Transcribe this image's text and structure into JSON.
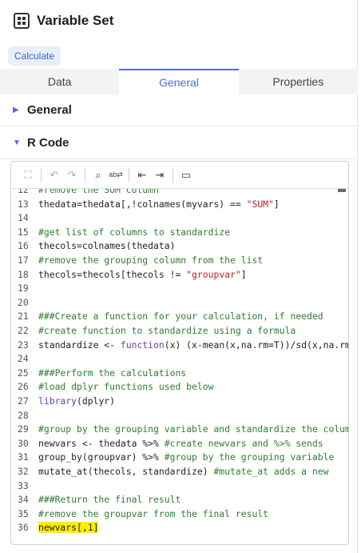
{
  "header": {
    "title": "Variable Set",
    "icon": "grid-icon"
  },
  "calculate_label": "Calculate",
  "tabs": [
    {
      "label": "Data",
      "active": false
    },
    {
      "label": "General",
      "active": true
    },
    {
      "label": "Properties",
      "active": false
    }
  ],
  "sections": [
    {
      "label": "General",
      "expanded": false
    },
    {
      "label": "R Code",
      "expanded": true
    }
  ],
  "colors": {
    "accent": "#4a6fe0",
    "comment": "#2e7d32",
    "string": "#b5251e",
    "keyword": "#6a3fa0",
    "highlight": "#ffee00"
  },
  "toolbar": [
    "expand-icon",
    "undo-icon",
    "redo-icon",
    "search-icon",
    "replace-icon",
    "outdent-icon",
    "indent-icon",
    "comment-icon"
  ],
  "code_lines": [
    {
      "n": "12",
      "segs": [
        [
          "c",
          "#remove the SUM column"
        ]
      ]
    },
    {
      "n": "13",
      "segs": [
        [
          "t",
          "thedata=thedata[,!colnames(myvars) == "
        ],
        [
          "s",
          "\"SUM\""
        ],
        [
          "t",
          "]"
        ]
      ]
    },
    {
      "n": "14",
      "segs": []
    },
    {
      "n": "15",
      "segs": [
        [
          "c",
          "#get list of columns to standardize"
        ]
      ]
    },
    {
      "n": "16",
      "segs": [
        [
          "t",
          "thecols=colnames(thedata)"
        ]
      ]
    },
    {
      "n": "17",
      "segs": [
        [
          "c",
          "#remove the grouping column from the list"
        ]
      ]
    },
    {
      "n": "18",
      "segs": [
        [
          "t",
          "thecols=thecols[thecols != "
        ],
        [
          "s",
          "\"groupvar\""
        ],
        [
          "t",
          "]"
        ]
      ]
    },
    {
      "n": "19",
      "segs": []
    },
    {
      "n": "20",
      "segs": []
    },
    {
      "n": "21",
      "segs": [
        [
          "c",
          "###Create a function for your calculation, if needed"
        ]
      ]
    },
    {
      "n": "22",
      "segs": [
        [
          "c",
          "#create function to standardize using a formula"
        ]
      ]
    },
    {
      "n": "23",
      "segs": [
        [
          "t",
          "standardize <- "
        ],
        [
          "k",
          "function"
        ],
        [
          "t",
          "(x) (x-mean(x,na.rm=T))/sd(x,na.rm=T)"
        ]
      ]
    },
    {
      "n": "24",
      "segs": []
    },
    {
      "n": "25",
      "segs": [
        [
          "c",
          "###Perform the calculations"
        ]
      ]
    },
    {
      "n": "26",
      "segs": [
        [
          "c",
          "#load dplyr functions used below"
        ]
      ]
    },
    {
      "n": "27",
      "segs": [
        [
          "k",
          "library"
        ],
        [
          "t",
          "(dplyr)"
        ]
      ]
    },
    {
      "n": "28",
      "segs": []
    },
    {
      "n": "29",
      "segs": [
        [
          "c",
          "#group by the grouping variable and standardize the columns"
        ]
      ]
    },
    {
      "n": "30",
      "segs": [
        [
          "t",
          "newvars <- thedata %>% "
        ],
        [
          "c",
          "#create newvars and %>% sends"
        ]
      ]
    },
    {
      "n": "31",
      "segs": [
        [
          "t",
          "group_by(groupvar) %>% "
        ],
        [
          "c",
          "#group by the grouping variable"
        ]
      ]
    },
    {
      "n": "32",
      "segs": [
        [
          "t",
          "mutate_at(thecols, standardize) "
        ],
        [
          "c",
          "#mutate_at adds a new"
        ]
      ]
    },
    {
      "n": "33",
      "segs": []
    },
    {
      "n": "34",
      "segs": [
        [
          "c",
          "###Return the final result"
        ]
      ]
    },
    {
      "n": "35",
      "segs": [
        [
          "c",
          "#remove the groupvar from the final result"
        ]
      ]
    },
    {
      "n": "36",
      "segs": [
        [
          "h",
          "newvars[,1]"
        ]
      ]
    }
  ]
}
